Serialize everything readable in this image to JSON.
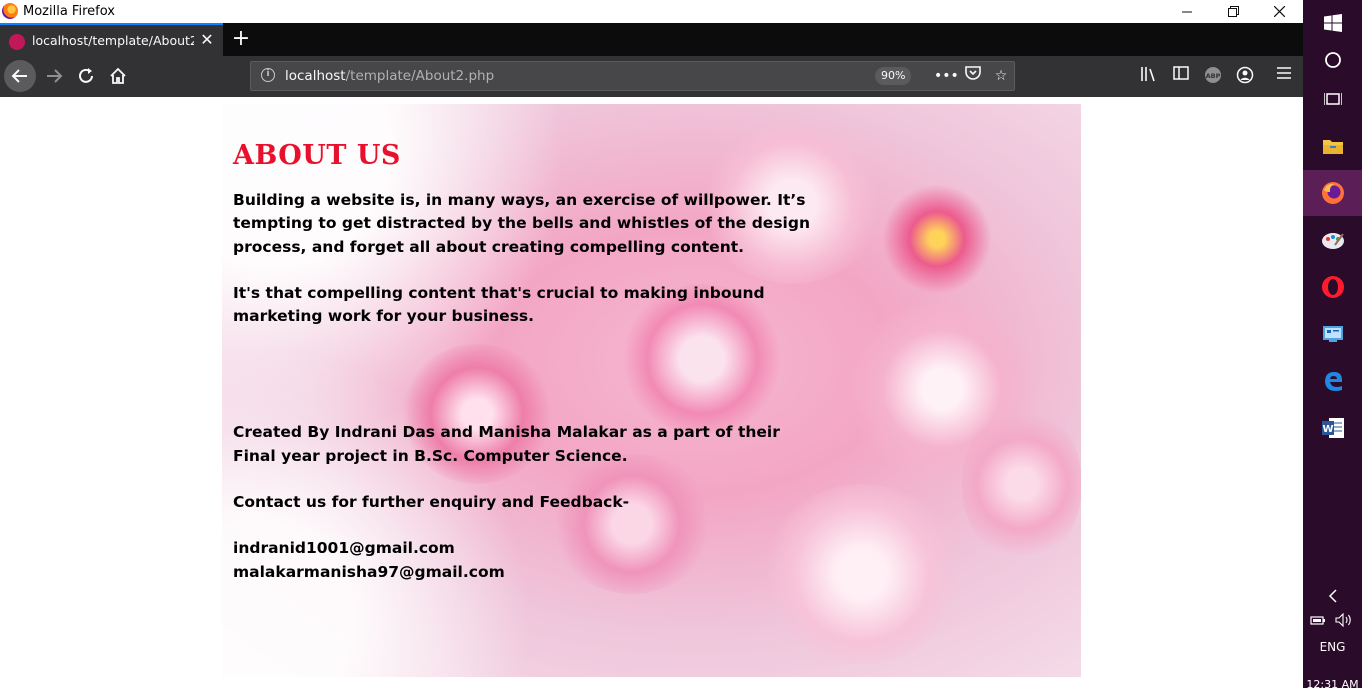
{
  "window": {
    "title": "Mozilla Firefox"
  },
  "tab": {
    "title": "localhost/template/About2.php"
  },
  "urlbar": {
    "host": "localhost",
    "path": "/template/About2.php",
    "zoom": "90%"
  },
  "page": {
    "heading": "ABOUT US",
    "paragraph1": "Building a website is, in many ways, an exercise of willpower. It’s tempting to get distracted by the bells and whistles of the design process, and forget all about creating compelling content.",
    "paragraph2": "It's that compelling content that's crucial to making inbound marketing work for your business.",
    "credits": "Created By Indrani Das and Manisha Malakar as a part of their Final year project in B.Sc. Computer Science.",
    "contact_label": "Contact us for further enquiry and Feedback-",
    "email1": "indranid1001@gmail.com",
    "email2": "malakarmanisha97@gmail.com"
  },
  "taskbar": {
    "language": "ENG",
    "clock": "12:31 AM"
  },
  "icons": {
    "nav": [
      "back-icon",
      "forward-icon",
      "reload-icon",
      "home-icon"
    ],
    "toolbar": [
      "library-icon",
      "sidebar-icon",
      "adblock-icon",
      "account-icon",
      "menu-icon"
    ],
    "taskbar": [
      "windows-start-icon",
      "search-icon",
      "task-view-icon",
      "file-explorer-icon",
      "firefox-icon",
      "paint-icon",
      "opera-icon",
      "control-panel-icon",
      "edge-icon",
      "word-icon"
    ]
  },
  "colors": {
    "heading": "#e8112d",
    "tab_accent": "#0a84ff",
    "taskbar": "#2b0b2a"
  }
}
